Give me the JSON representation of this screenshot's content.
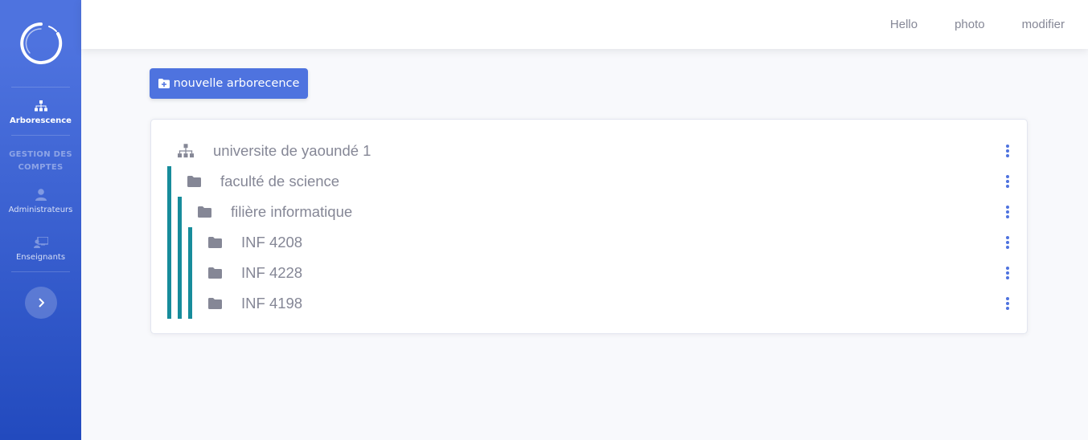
{
  "topbar": {
    "links": [
      "Hello",
      "photo",
      "modifier"
    ]
  },
  "sidebar": {
    "logo_icon": "circle-logo-icon",
    "items": [
      {
        "label": "Arborescence",
        "icon": "sitemap-icon",
        "active": true
      }
    ],
    "heading": "GESTION DES COMPTES",
    "accounts": [
      {
        "label": "Administrateurs",
        "icon": "user-icon"
      },
      {
        "label": "Enseignants",
        "icon": "teacher-icon"
      }
    ],
    "toggle_icon": "chevron-right-icon"
  },
  "main": {
    "new_tree_label": "nouvelle arborecence",
    "tree": [
      {
        "name": "universite de yaoundé 1",
        "level": 0,
        "icon": "sitemap-icon"
      },
      {
        "name": "faculté de science",
        "level": 1,
        "icon": "folder-icon"
      },
      {
        "name": "filière informatique",
        "level": 2,
        "icon": "folder-icon"
      },
      {
        "name": "INF 4208",
        "level": 3,
        "icon": "folder-icon"
      },
      {
        "name": "INF 4228",
        "level": 3,
        "icon": "folder-icon"
      },
      {
        "name": "INF 4198",
        "level": 3,
        "icon": "folder-icon"
      }
    ]
  },
  "colors": {
    "primary": "#4e73df",
    "tree_line": "#178c9b",
    "text_muted": "#858796"
  }
}
